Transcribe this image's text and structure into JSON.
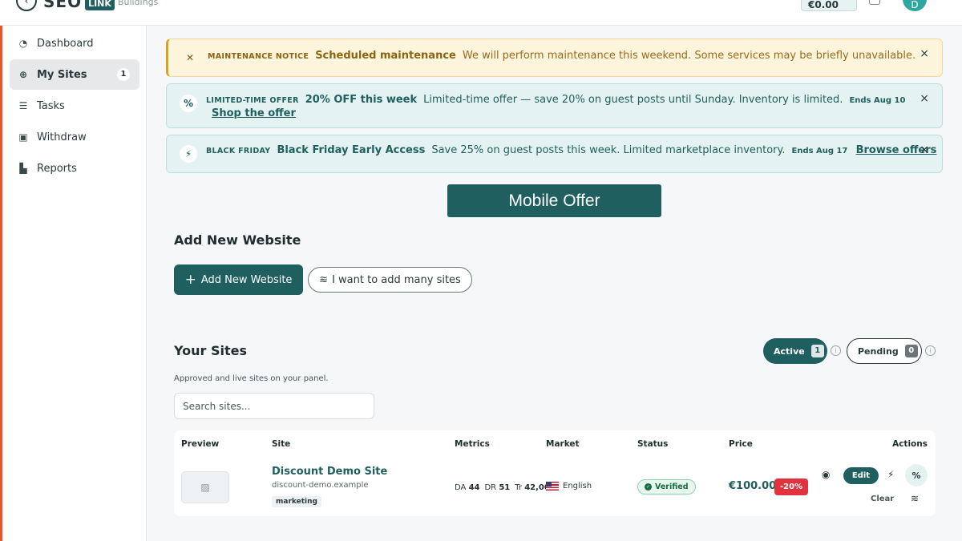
{
  "header": {
    "logo_seo": "SEO",
    "logo_box": "LINK",
    "logo_sub": "Buildings",
    "balance": "€0.00",
    "avatar": "D"
  },
  "sidebar": {
    "items": [
      {
        "label": "Dashboard",
        "icon": "dashboard-icon"
      },
      {
        "label": "My Sites",
        "icon": "globe-icon",
        "badge": "1",
        "active": true
      },
      {
        "label": "Tasks",
        "icon": "tasks-icon"
      },
      {
        "label": "Withdraw",
        "icon": "wallet-icon"
      },
      {
        "label": "Reports",
        "icon": "chart-icon"
      }
    ]
  },
  "banners": {
    "maintenance": {
      "tag": "MAINTENANCE NOTICE",
      "title": "Scheduled maintenance",
      "text": "We will perform maintenance this weekend. Some services may be briefly unavailable.",
      "close": "×"
    },
    "offer": {
      "tag": "LIMITED-TIME OFFER",
      "title": "20% OFF this week",
      "text": "Limited-time offer — save 20% on guest posts until Sunday. Inventory is limited.",
      "ends": "Ends Aug 10",
      "link": "Shop the offer",
      "close": "×"
    },
    "blackfriday": {
      "tag": "BLACK FRIDAY",
      "title": "Black Friday Early Access",
      "text": "Save 25% on guest posts this week. Limited marketplace inventory.",
      "ends": "Ends Aug 17",
      "link": "Browse offers",
      "close": "×"
    }
  },
  "mobile_offer": "Mobile Offer",
  "add_section": {
    "title": "Add New Website",
    "add_button": "Add New Website",
    "bulk_button": "I want to add many sites"
  },
  "sites": {
    "title": "Your Sites",
    "subtitle": "Approved and live sites on your panel.",
    "search_placeholder": "Search sites...",
    "tabs": [
      {
        "label": "Active",
        "count": "1"
      },
      {
        "label": "Pending",
        "count": "0"
      }
    ],
    "columns": [
      "Preview",
      "Site",
      "Metrics",
      "Market",
      "Status",
      "Price",
      "Actions"
    ],
    "rows": [
      {
        "name": "Discount Demo Site",
        "url": "discount-demo.example",
        "tag": "marketing",
        "da_label": "DA",
        "da": "44",
        "dr_label": "DR",
        "dr": "51",
        "tr_label": "Tr",
        "tr": "42,000",
        "market": "English",
        "status": "Verified",
        "price": "€100.00",
        "discount": "-20%",
        "edit": "Edit",
        "clear": "Clear"
      }
    ]
  },
  "colors": {
    "brand": "#1f5f5f",
    "accent_bar": "#e05a2b",
    "warning": "#e0a020",
    "discount": "#e0333f"
  }
}
